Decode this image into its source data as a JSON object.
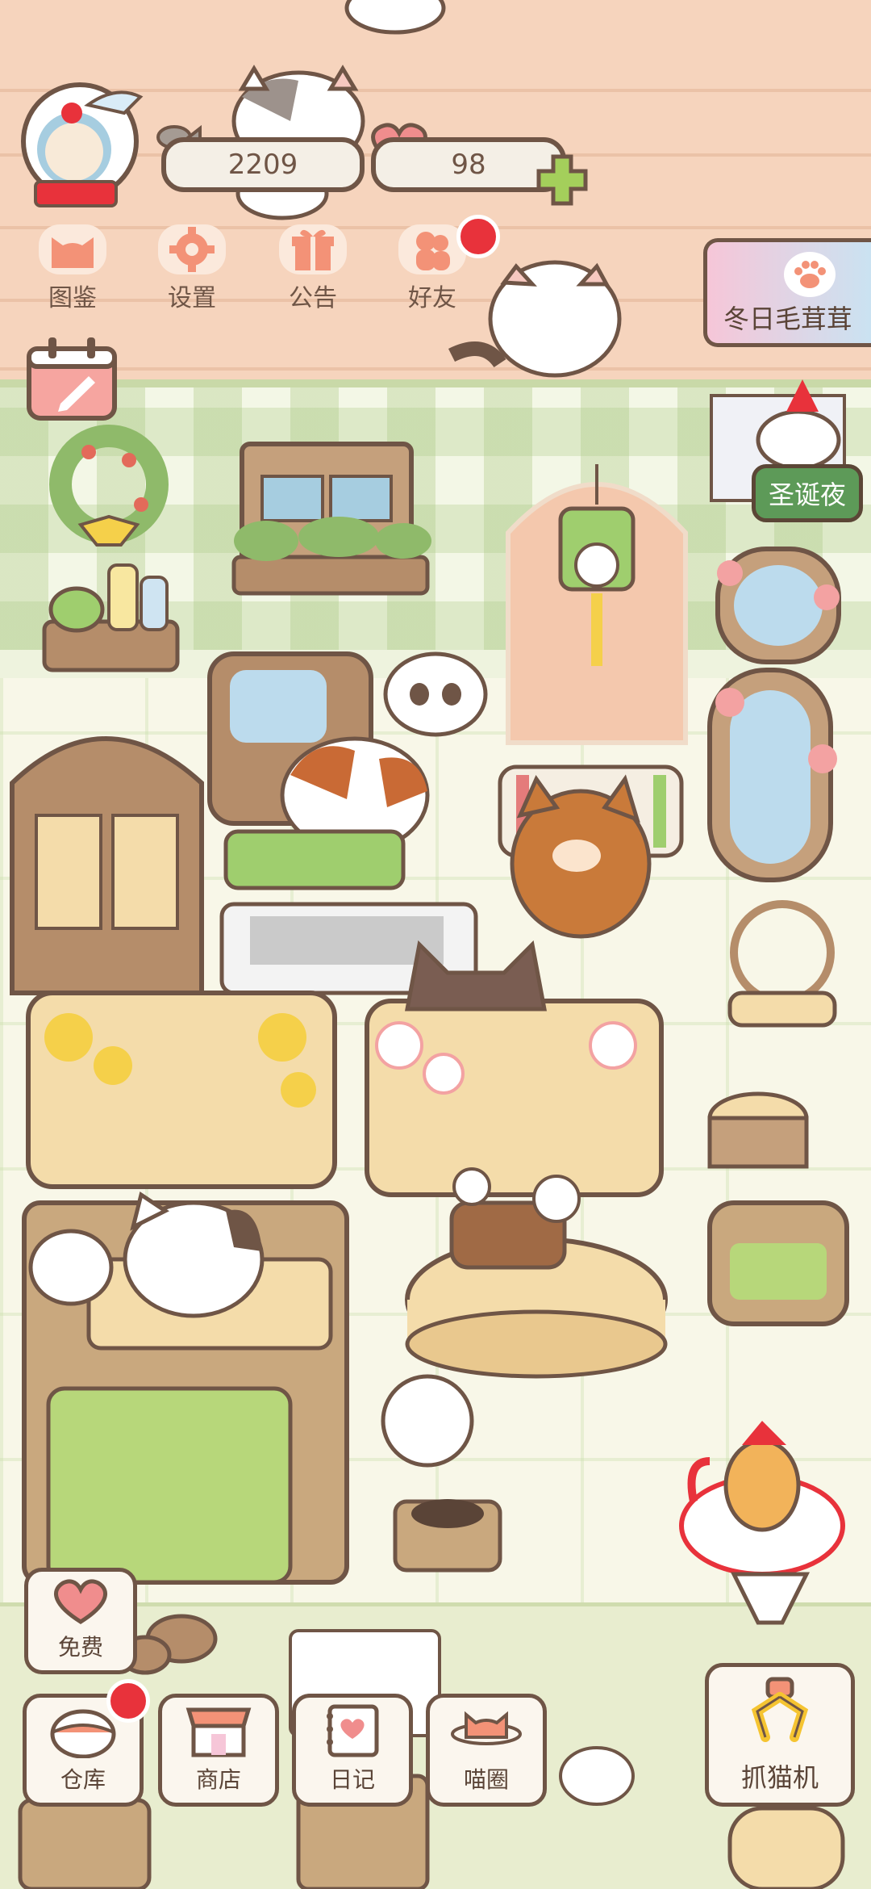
{
  "hud": {
    "fish_count": "2209",
    "heart_count": "98"
  },
  "top_menu": [
    {
      "label": "图鉴",
      "icon": "cat-face-icon",
      "badge": false
    },
    {
      "label": "设置",
      "icon": "gear-icon",
      "badge": false
    },
    {
      "label": "公告",
      "icon": "gift-icon",
      "badge": false
    },
    {
      "label": "好友",
      "icon": "friends-icon",
      "badge": true
    }
  ],
  "event_banner": {
    "label": "冬日毛茸茸",
    "icon": "paw-icon"
  },
  "event_tag": {
    "label": "圣诞夜"
  },
  "free_button": {
    "label": "免费",
    "icon": "heart-icon"
  },
  "bottom_menu": [
    {
      "label": "仓库",
      "icon": "warehouse-icon",
      "badge": true
    },
    {
      "label": "商店",
      "icon": "shop-icon",
      "badge": false
    },
    {
      "label": "日记",
      "icon": "diary-icon",
      "badge": false
    },
    {
      "label": "喵圈",
      "icon": "cat-planet-icon",
      "badge": false
    }
  ],
  "claw_machine": {
    "label": "抓猫机",
    "icon": "claw-icon"
  },
  "colors": {
    "outline": "#6f5546",
    "accent_red": "#e8323b",
    "wall": "#f6d4bd",
    "floor": "#f8f7e8",
    "green": "#5d9a58"
  }
}
